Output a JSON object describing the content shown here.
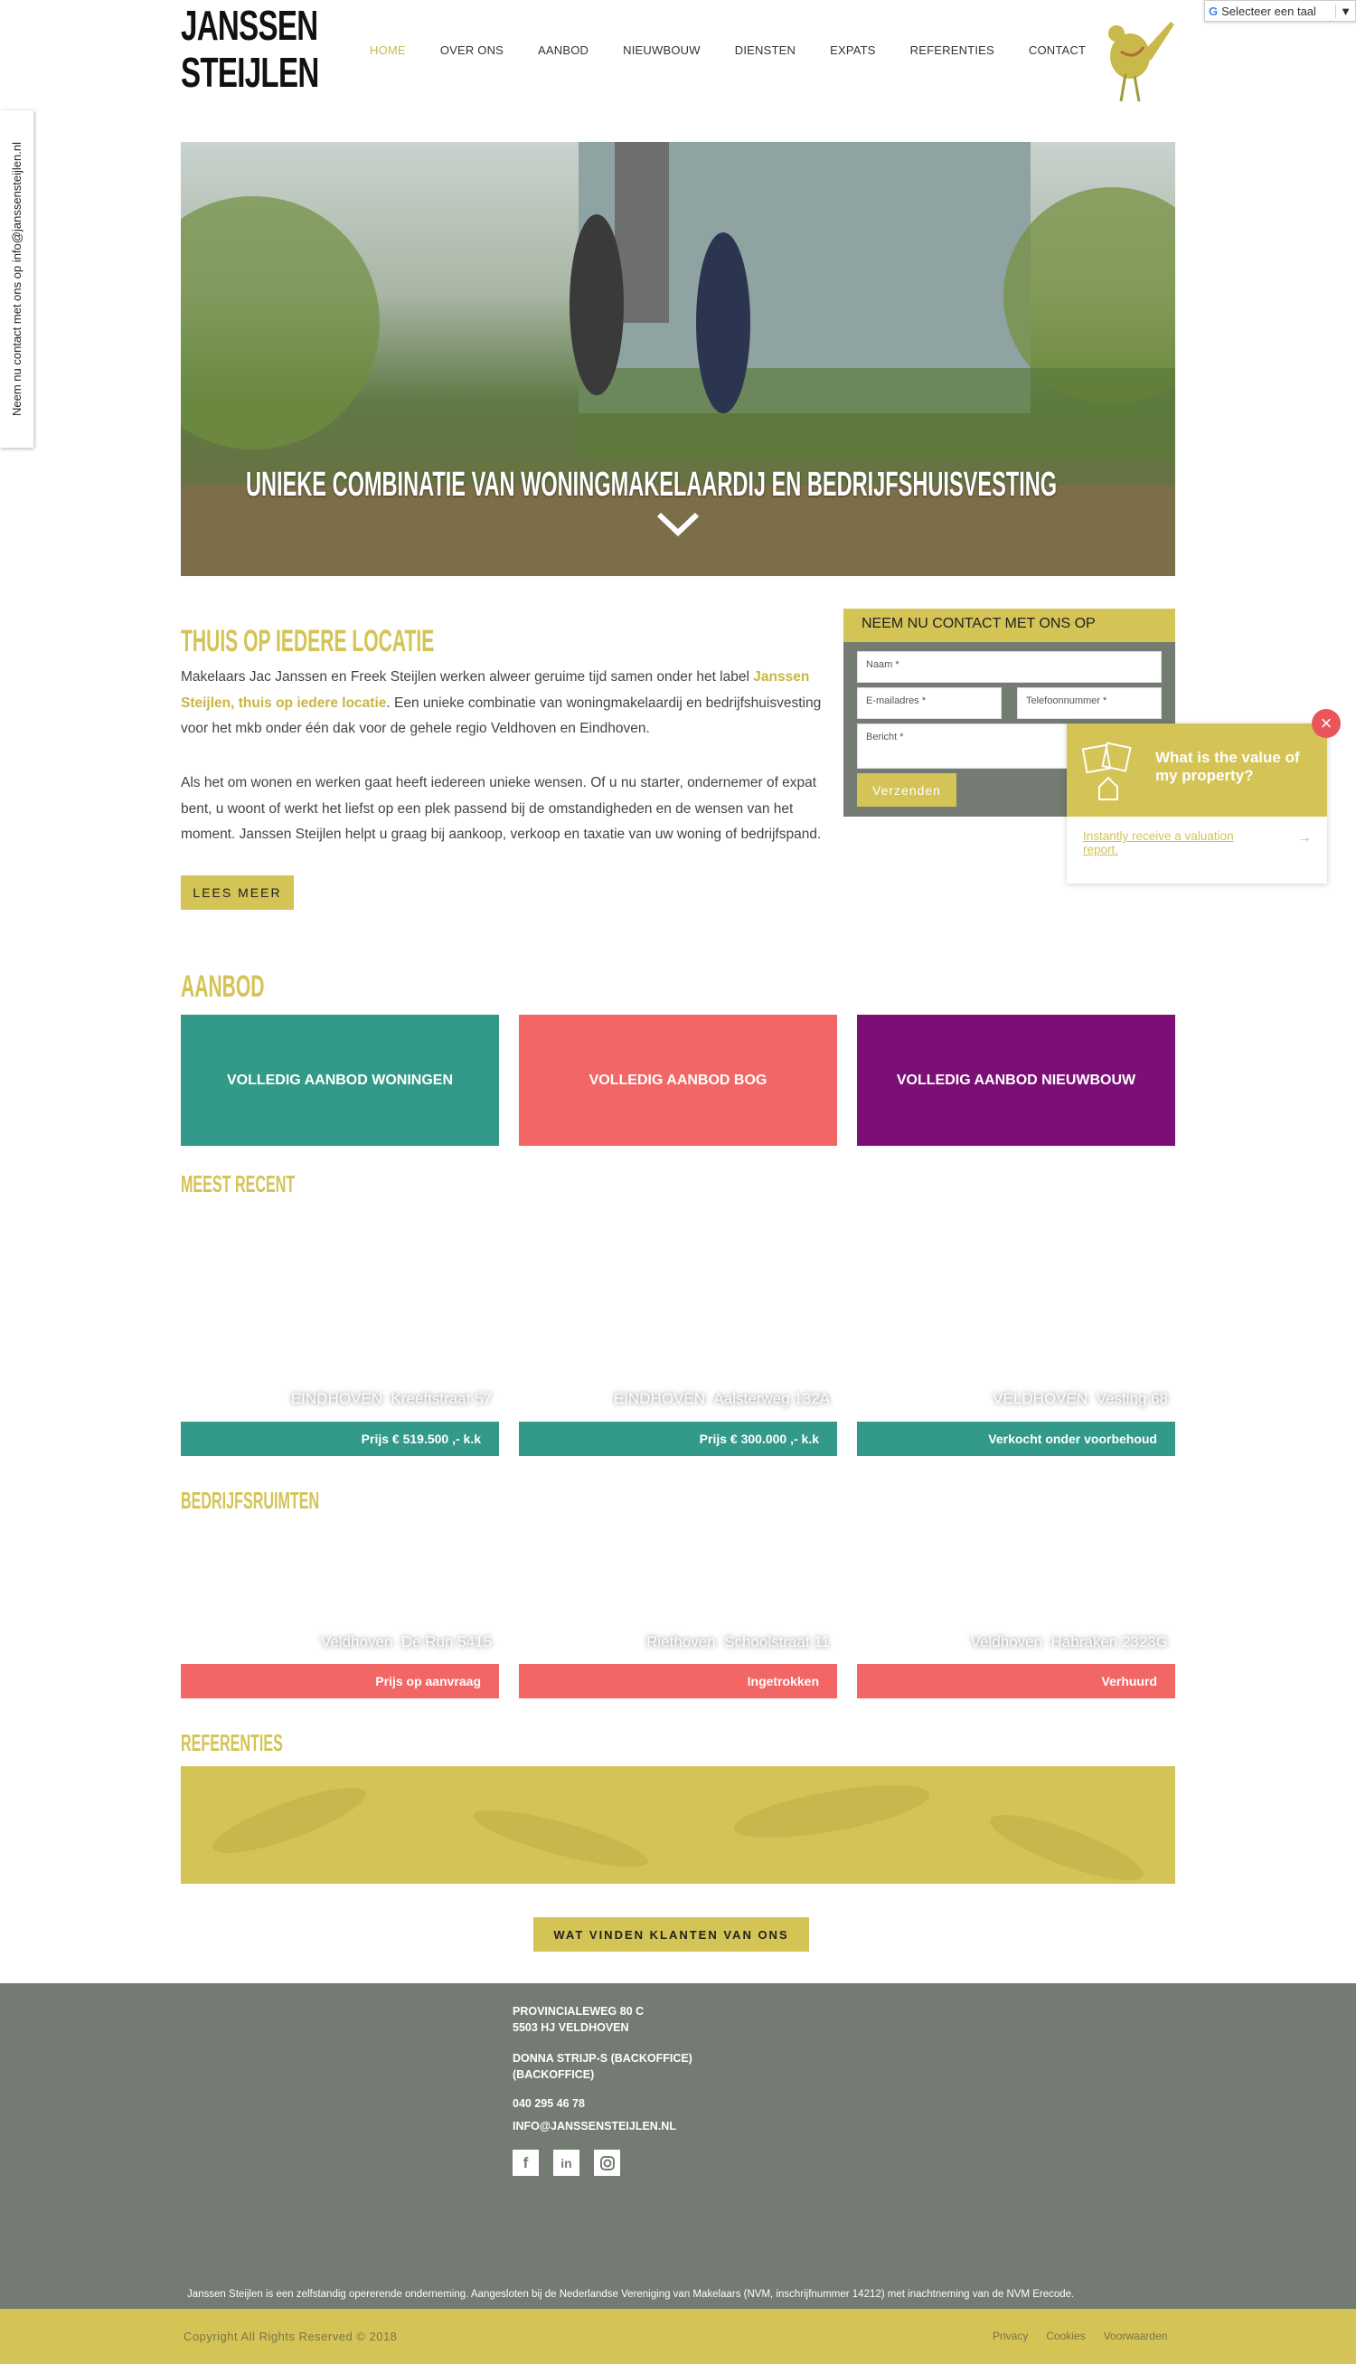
{
  "header": {
    "logo_line1": "JANSSEN",
    "logo_line2": "STEIJLEN",
    "nav": [
      "HOME",
      "OVER ONS",
      "AANBOD",
      "NIEUWBOUW",
      "DIENSTEN",
      "EXPATS",
      "REFERENTIES",
      "CONTACT"
    ],
    "active": "HOME",
    "translate_label": "Selecteer een taal"
  },
  "side_tab": "Neem nu contact met ons op info@janssensteijlen.nl",
  "hero": {
    "title": "UNIEKE COMBINATIE VAN WONINGMAKELAARDIJ EN BEDRIJFSHUISVESTING"
  },
  "intro": {
    "heading": "THUIS OP IEDERE LOCATIE",
    "p1_a": "Makelaars Jac Janssen en Freek Steijlen werken alweer geruime tijd samen onder het label ",
    "p1_link": "Janssen Steijlen, thuis op iedere locatie",
    "p1_b": ". Een unieke combinatie van woningmakelaardij en bedrijfshuisvesting voor het mkb onder één dak voor de gehele regio Veldhoven en Eindhoven.",
    "p2": "Als het om wonen en werken gaat heeft iedereen unieke wensen. Of u nu starter, ondernemer of expat bent, u woont of werkt het liefst op een plek passend bij de omstandigheden en de wensen van het moment. Janssen Steijlen helpt u graag bij aankoop, verkoop en taxatie van uw woning of bedrijfspand.",
    "button": "LEES MEER"
  },
  "contact_form": {
    "title": "NEEM NU CONTACT MET ONS OP",
    "name_placeholder": "Naam *",
    "email_placeholder": "E-mailadres *",
    "phone_placeholder": "Telefoonnummer *",
    "message_placeholder": "Bericht *",
    "submit": "Verzenden"
  },
  "valuation_popup": {
    "title": "What is the value of my property?",
    "link": "Instantly receive a valuation report.",
    "close": "×"
  },
  "aanbod": {
    "heading": "AANBOD",
    "tiles": [
      {
        "label": "VOLLEDIG AANBOD WONINGEN",
        "color": "#339988"
      },
      {
        "label": "VOLLEDIG AANBOD BOG",
        "color": "#f26665"
      },
      {
        "label": "VOLLEDIG AANBOD NIEUWBOUW",
        "color": "#7b0f75"
      }
    ]
  },
  "recent": {
    "heading": "MEEST RECENT",
    "items": [
      {
        "city": "EINDHOVEN",
        "street": "Kreeftstraat 57",
        "status": "Prijs € 519.500 ,- k.k"
      },
      {
        "city": "EINDHOVEN",
        "street": "Aalsterweg 132A",
        "status": "Prijs € 300.000 ,- k.k"
      },
      {
        "city": "VELDHOVEN",
        "street": "Vesting 68",
        "status": "Verkocht onder voorbehoud"
      }
    ]
  },
  "bedrijf": {
    "heading": "BEDRIJFSRUIMTEN",
    "items": [
      {
        "city": "Veldhoven",
        "street": "De Run 5415",
        "status": "Prijs op aanvraag"
      },
      {
        "city": "Riethoven",
        "street": "Schoolstraat 11",
        "status": "Ingetrokken"
      },
      {
        "city": "Veldhoven",
        "street": "Habraken 2323G",
        "status": "Verhuurd"
      }
    ]
  },
  "referenties": {
    "heading": "REFERENTIES",
    "button": "WAT VINDEN KLANTEN VAN ONS"
  },
  "footer": {
    "addr1": "PROVINCIALEWEG 80 C",
    "addr2": "5503 HJ VELDHOVEN",
    "office1": "DONNA STRIJP-S (BACKOFFICE)",
    "office2": "(BACKOFFICE)",
    "phone": "040 295 46 78",
    "email": "INFO@JANSSENSTEIJLEN.NL",
    "disclaimer": "Janssen Steijlen is een zelfstandig opererende onderneming. Aangesloten bij de Nederlandse Vereniging van Makelaars (NVM, inschrijfnummer 14212) met inachtneming van de NVM Erecode.",
    "copyright": "Copyright All Rights Reserved © 2018",
    "links": [
      "Privacy",
      "Cookies",
      "Voorwaarden"
    ]
  },
  "colors": {
    "accent": "#d4c355",
    "footer": "#737b72",
    "teal": "#339988",
    "coral": "#f26665",
    "purple": "#7b0f75"
  }
}
